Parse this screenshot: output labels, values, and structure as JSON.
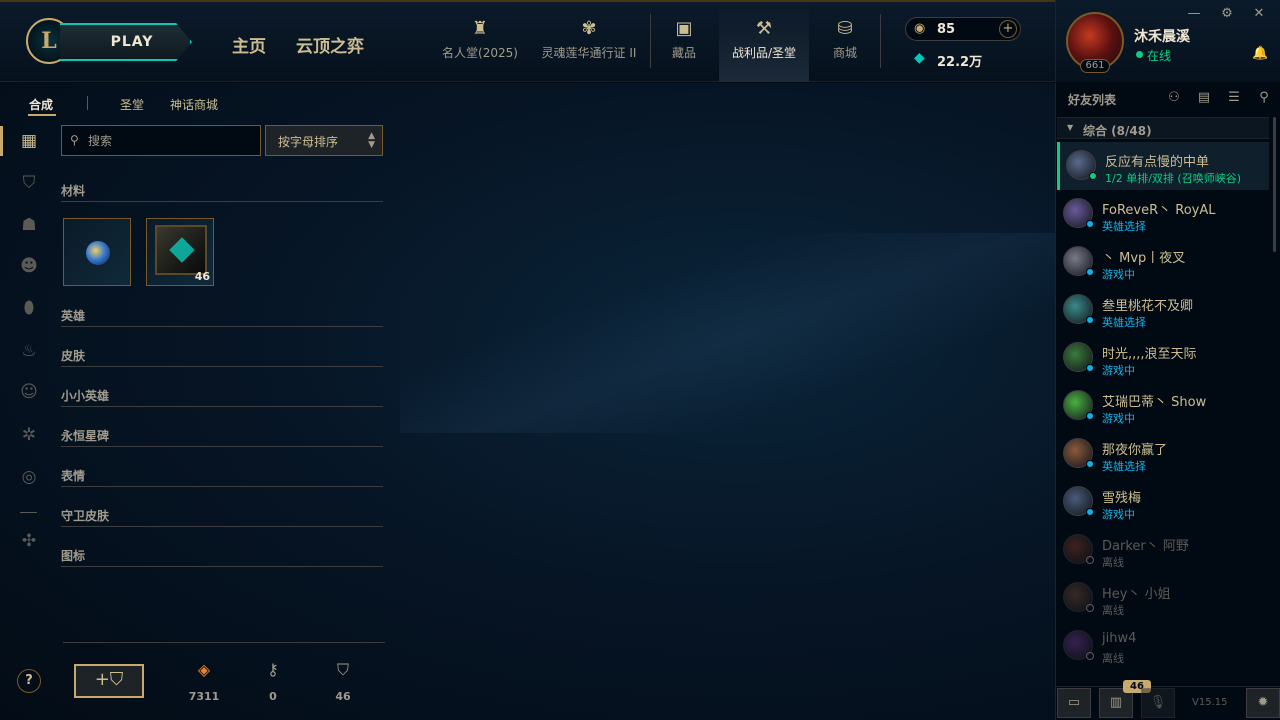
{
  "header": {
    "logo_letter": "L",
    "play_label": "PLAY",
    "nav_main": [
      "主页",
      "云顶之弈"
    ],
    "nav_items": [
      {
        "label": "名人堂(2025)",
        "icon": "trophy-icon"
      },
      {
        "label": "灵魂莲华通行证 II",
        "icon": "lotus-icon"
      },
      {
        "label": "藏品",
        "icon": "collection-icon"
      },
      {
        "label": "战利品/圣堂",
        "icon": "loot-icon"
      },
      {
        "label": "商城",
        "icon": "store-icon"
      }
    ],
    "active_nav": "战利品/圣堂",
    "currency": {
      "rp": "85",
      "blue_essence": "22.2万"
    },
    "profile": {
      "name": "沐禾晨溪",
      "level": "661",
      "status": "在线"
    }
  },
  "loot": {
    "subtabs": [
      "合成",
      "圣堂",
      "神话商城"
    ],
    "active_subtab": "合成",
    "search_placeholder": "搜索",
    "sort_label": "按字母排序",
    "categories": [
      {
        "label": "材料"
      },
      {
        "label": "英雄"
      },
      {
        "label": "皮肤"
      },
      {
        "label": "小小英雄"
      },
      {
        "label": "永恒星碑"
      },
      {
        "label": "表情"
      },
      {
        "label": "守卫皮肤"
      },
      {
        "label": "图标"
      }
    ],
    "material_items": [
      {
        "name": "essence-orb",
        "count": ""
      },
      {
        "name": "hextech-chest",
        "count": "46"
      }
    ],
    "side_icons": [
      "grid-icon",
      "chest-icon",
      "helmet-icon",
      "mask-icon",
      "egg-icon",
      "flame-icon",
      "emote-icon",
      "ward-icon",
      "profile-icon",
      "shard-icon"
    ],
    "stats": [
      {
        "icon": "orange-essence-icon",
        "value": "7311"
      },
      {
        "icon": "key-icon",
        "value": "0"
      },
      {
        "icon": "chest-icon",
        "value": "46"
      }
    ],
    "help_label": "?"
  },
  "friends": {
    "title": "好友列表",
    "group_label": "综合 (8/48)",
    "list": [
      {
        "name": "反应有点慢的中单",
        "status": "1/2 单排/双排 (召唤师峡谷)",
        "state": "ingame-green",
        "avatar_color": "#5a6a8a",
        "selected": true
      },
      {
        "name": "FoReveR丶 RoyAL",
        "status": "英雄选择",
        "state": "champselect",
        "avatar_color": "#6a5a9a"
      },
      {
        "name": "丶 Mvp丨夜叉",
        "status": "游戏中",
        "state": "ingame",
        "avatar_color": "#7a7a8a"
      },
      {
        "name": "叁里桃花不及卿",
        "status": "英雄选择",
        "state": "champselect",
        "avatar_color": "#3a8a8a"
      },
      {
        "name": "时光,,,,浪至天际",
        "status": "游戏中",
        "state": "ingame",
        "avatar_color": "#3a7a3a"
      },
      {
        "name": "艾瑞巴蒂丶 Show",
        "status": "游戏中",
        "state": "ingame",
        "avatar_color": "#4ab040"
      },
      {
        "name": "那夜你赢了",
        "status": "英雄选择",
        "state": "champselect",
        "avatar_color": "#8a5a3a"
      },
      {
        "name": "雪残梅",
        "status": "游戏中",
        "state": "ingame",
        "avatar_color": "#4a5a7a"
      },
      {
        "name": "Darker丶 阿野",
        "status": "离线",
        "state": "offline",
        "avatar_color": "#7a3a2a"
      },
      {
        "name": "Hey丶 小姐",
        "status": "离线",
        "state": "offline",
        "avatar_color": "#6a4a3a"
      },
      {
        "name": "jihw4",
        "status": "离线",
        "state": "offline",
        "avatar_color": "#6a3a8a"
      }
    ],
    "footer_badge": "46",
    "version": "V15.15"
  },
  "colors": {
    "gold": "#c8aa6e",
    "teal": "#0ac8b9",
    "online_green": "#0acf83",
    "champselect_blue": "#0ab4e6"
  }
}
